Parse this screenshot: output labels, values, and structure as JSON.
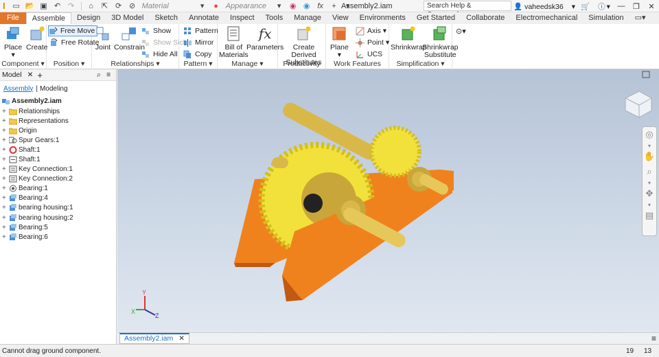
{
  "titlebar": {
    "material_label": "Material",
    "appearance_label": "Appearance",
    "doc_title": "Assembly2.iam",
    "search_placeholder": "Search Help & Commands...",
    "username": "vaheedsk36"
  },
  "ribbon_tabs": [
    "File",
    "Assemble",
    "Design",
    "3D Model",
    "Sketch",
    "Annotate",
    "Inspect",
    "Tools",
    "Manage",
    "View",
    "Environments",
    "Get Started",
    "Collaborate",
    "Electromechanical",
    "Simulation"
  ],
  "ribbon": {
    "component": {
      "title": "Component ▾",
      "place": "Place",
      "create": "Create"
    },
    "position": {
      "title": "Position ▾",
      "free_move": "Free Move",
      "free_rotate": "Free Rotate"
    },
    "relationships": {
      "title": "Relationships ▾",
      "joint": "Joint",
      "constrain": "Constrain",
      "show": "Show",
      "show_sick": "Show Sick",
      "hide_all": "Hide All"
    },
    "pattern": {
      "title": "Pattern ▾",
      "pattern": "Pattern",
      "mirror": "Mirror",
      "copy": "Copy"
    },
    "manage": {
      "title": "Manage ▾",
      "bom_line1": "Bill of",
      "bom_line2": "Materials",
      "parameters": "Parameters"
    },
    "productivity": {
      "title": "Productivity",
      "cds_line1": "Create Derived",
      "cds_line2": "Substitutes"
    },
    "work_features": {
      "title": "Work Features",
      "plane": "Plane",
      "axis": "Axis ▾",
      "point": "Point ▾",
      "ucs": "UCS"
    },
    "simplification": {
      "title": "Simplification ▾",
      "shrinkwrap": "Shrinkwrap",
      "sws_line1": "Shrinkwrap",
      "sws_line2": "Substitute"
    }
  },
  "browser": {
    "tab_label": "Model",
    "subtab_assembly": "Assembly",
    "subtab_modeling": "Modeling",
    "root": "Assembly2.iam",
    "items": [
      {
        "label": "Relationships",
        "icon": "folder-icon"
      },
      {
        "label": "Representations",
        "icon": "folder-icon"
      },
      {
        "label": "Origin",
        "icon": "folder-icon"
      },
      {
        "label": "Spur Gears:1",
        "icon": "gear-part-icon"
      },
      {
        "label": "Shaft:1",
        "icon": "shaft-rotating-icon"
      },
      {
        "label": "Shaft:1",
        "icon": "shaft-icon"
      },
      {
        "label": "Key Connection:1",
        "icon": "key-connection-icon"
      },
      {
        "label": "Key Connection:2",
        "icon": "key-connection-icon"
      },
      {
        "label": "Bearing:1",
        "icon": "bearing-icon"
      },
      {
        "label": "Bearing:4",
        "icon": "part-icon"
      },
      {
        "label": "bearing housing:1",
        "icon": "part-icon"
      },
      {
        "label": "bearing housing:2",
        "icon": "part-icon"
      },
      {
        "label": "Bearing:5",
        "icon": "part-icon"
      },
      {
        "label": "Bearing:6",
        "icon": "part-icon"
      }
    ]
  },
  "document_tab": "Assembly2.iam",
  "status": {
    "message": "Cannot drag ground component.",
    "count1": "19",
    "count2": "13"
  },
  "colors": {
    "file_tab": "#e0772a",
    "gear": "#f2e13a",
    "plate": "#f0821e",
    "shaft": "#d9b84a",
    "accent": "#1a6fc4"
  }
}
